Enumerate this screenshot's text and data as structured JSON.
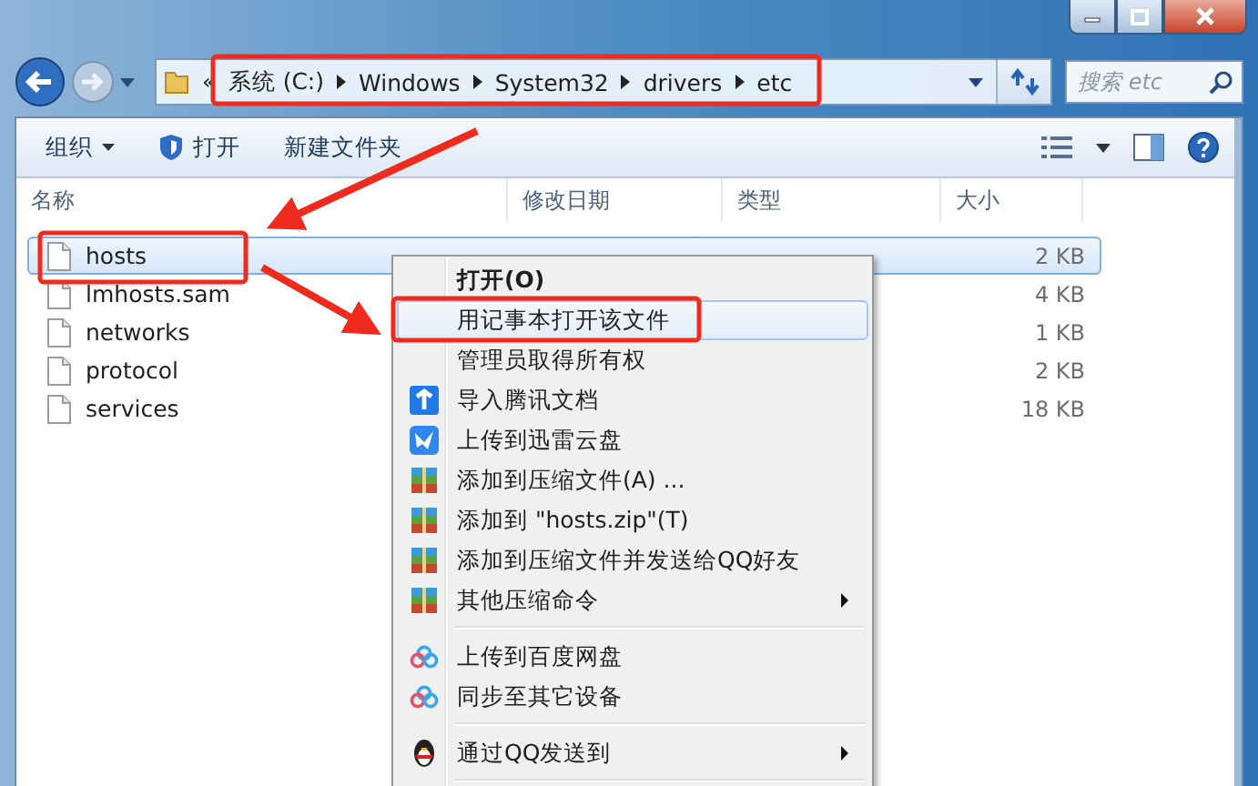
{
  "address_bar": {
    "overflow": "«",
    "crumbs": [
      "系统 (C:)",
      "Windows",
      "System32",
      "drivers",
      "etc"
    ]
  },
  "search": {
    "placeholder": "搜索 etc"
  },
  "toolbar": {
    "items": [
      {
        "label": "组织",
        "kind": "menu"
      },
      {
        "label": "打开",
        "kind": "open"
      },
      {
        "label": "新建文件夹",
        "kind": "plain"
      }
    ]
  },
  "table": {
    "columns": [
      "名称",
      "修改日期",
      "类型",
      "大小"
    ],
    "rows": [
      {
        "name": "hosts",
        "size": "2 KB",
        "selected": true
      },
      {
        "name": "lmhosts.sam",
        "size": "4 KB",
        "selected": false
      },
      {
        "name": "networks",
        "size": "1 KB",
        "selected": false
      },
      {
        "name": "protocol",
        "size": "2 KB",
        "selected": false
      },
      {
        "name": "services",
        "size": "18 KB",
        "selected": false
      }
    ]
  },
  "context_menu": {
    "items": [
      {
        "kind": "item",
        "label": "打开(O)",
        "bold": true,
        "selected": false
      },
      {
        "kind": "item",
        "label": "用记事本打开该文件",
        "selected": true
      },
      {
        "kind": "item",
        "label": "管理员取得所有权",
        "selected": false
      },
      {
        "kind": "docs",
        "label": "导入腾讯文档",
        "selected": false
      },
      {
        "kind": "cloud",
        "label": "上传到迅雷云盘",
        "selected": false
      },
      {
        "kind": "archive",
        "label": "添加到压缩文件(A) ...",
        "selected": false
      },
      {
        "kind": "archive",
        "label": "添加到 \"hosts.zip\"(T)",
        "selected": false
      },
      {
        "kind": "archive",
        "label": "添加到压缩文件并发送给QQ好友",
        "selected": false
      },
      {
        "kind": "archive",
        "label": "其他压缩命令",
        "submenu": true,
        "selected": false
      },
      {
        "kind": "separator"
      },
      {
        "kind": "netdisk",
        "label": "上传到百度网盘",
        "selected": false
      },
      {
        "kind": "netdisk",
        "label": "同步至其它设备",
        "selected": false
      },
      {
        "kind": "separator"
      },
      {
        "kind": "qq",
        "label": "通过QQ发送到",
        "submenu": true,
        "selected": false
      },
      {
        "kind": "separator"
      }
    ]
  }
}
